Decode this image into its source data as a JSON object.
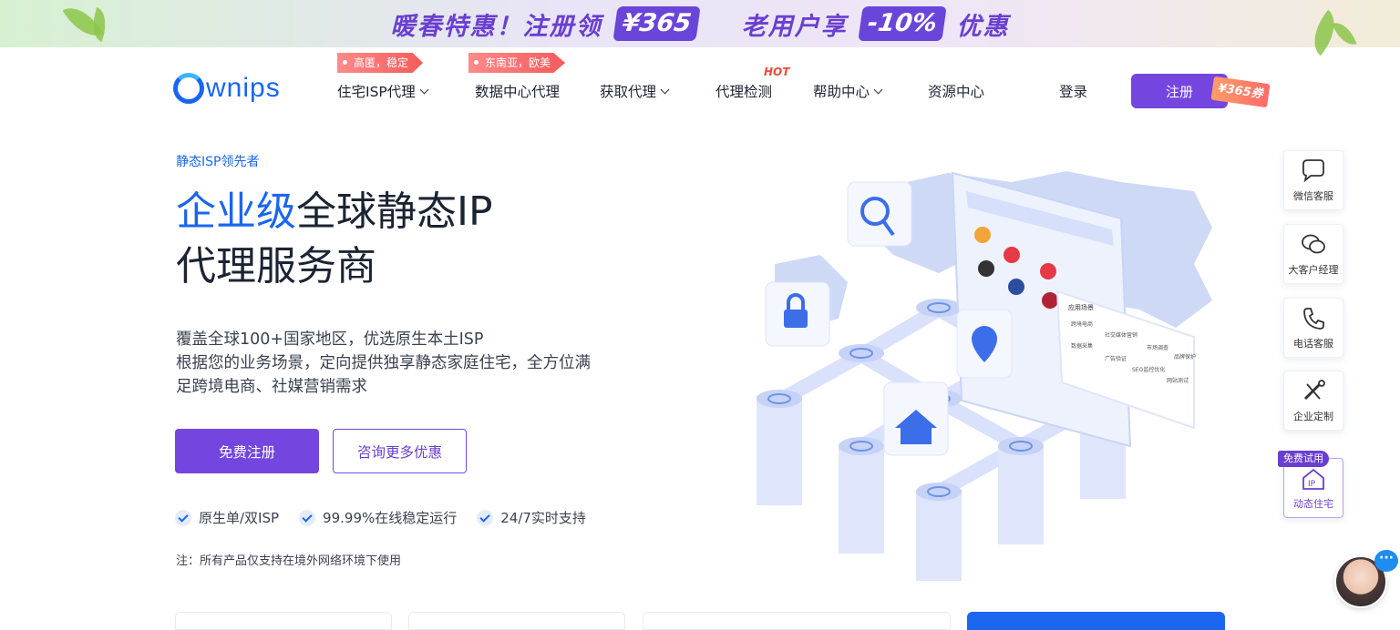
{
  "promo": {
    "text1": "暖春特惠！注册领",
    "badge1": "¥365",
    "text2": "老用户享",
    "badge2": "-10%",
    "text3": "优惠"
  },
  "header": {
    "logo_text": "wnips",
    "nav": [
      {
        "label": "住宅ISP代理",
        "tag": "高匿，稳定",
        "dropdown": true
      },
      {
        "label": "数据中心代理",
        "tag": "东南亚，欧美",
        "dropdown": false
      },
      {
        "label": "获取代理",
        "dropdown": true
      },
      {
        "label": "代理检测",
        "badge": "HOT",
        "dropdown": false
      },
      {
        "label": "帮助中心",
        "dropdown": true
      },
      {
        "label": "资源中心",
        "dropdown": false
      }
    ],
    "login": "登录",
    "register": "注册",
    "coupon": "¥365券"
  },
  "hero": {
    "kicker": "静态ISP领先者",
    "title_accent": "企业级",
    "title_rest": "全球静态IP",
    "title_line2": "代理服务商",
    "desc_line1": "覆盖全球100+国家地区，优选原生本土ISP",
    "desc_line2": "根据您的业务场景，定向提供独享静态家庭住宅，全方位满足跨境电商、社媒营销需求",
    "primary_btn": "免费注册",
    "secondary_btn": "咨询更多优惠",
    "features": [
      "原生单/双ISP",
      "99.99%在线稳定运行",
      "24/7实时支持"
    ],
    "note": "注：所有产品仅支持在境外网络环境下使用"
  },
  "illustration": {
    "panel_title": "应用场景",
    "tags": [
      "跨境电商",
      "社交媒体营销",
      "市场调查",
      "品牌保护",
      "数据采集",
      "广告验证",
      "SEO监控优化",
      "网站测试"
    ]
  },
  "side": {
    "items": [
      {
        "label": "微信客服",
        "icon": "chat-icon"
      },
      {
        "label": "大客户经理",
        "icon": "wechat-icon"
      },
      {
        "label": "电话客服",
        "icon": "phone-icon"
      },
      {
        "label": "企业定制",
        "icon": "tools-icon"
      },
      {
        "label": "动态住宅",
        "icon": "ip-home-icon"
      }
    ],
    "trial_tag": "免费试用",
    "chat_dots": "···"
  },
  "colors": {
    "brand_blue": "#1a66ee",
    "brand_purple": "#7446df",
    "hot_red": "#f04a3a"
  }
}
